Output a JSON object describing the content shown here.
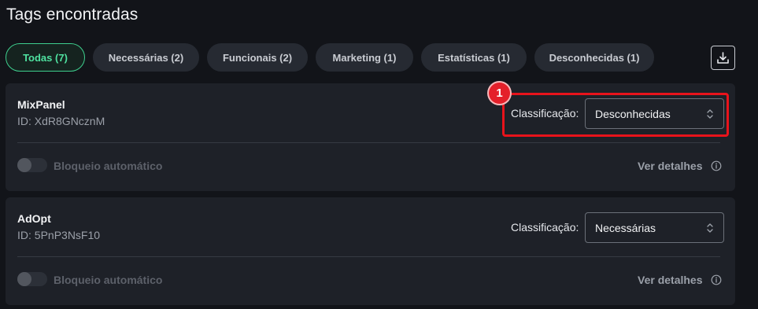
{
  "page": {
    "title": "Tags encontradas"
  },
  "filters": [
    {
      "label": "Todas (7)",
      "active": true
    },
    {
      "label": "Necessárias (2)",
      "active": false
    },
    {
      "label": "Funcionais (2)",
      "active": false
    },
    {
      "label": "Marketing (1)",
      "active": false
    },
    {
      "label": "Estatísticas (1)",
      "active": false
    },
    {
      "label": "Desconhecidas (1)",
      "active": false
    }
  ],
  "download": {
    "icon": "download-icon"
  },
  "tags": [
    {
      "name": "MixPanel",
      "id": "ID: XdR8GNcznM",
      "classification_label": "Classificação:",
      "classification_value": "Desconhecidas",
      "auto_block_label": "Bloqueio automático",
      "auto_block_enabled": false,
      "details_label": "Ver detalhes"
    },
    {
      "name": "AdOpt",
      "id": "ID: 5PnP3NsF10",
      "classification_label": "Classificação:",
      "classification_value": "Necessárias",
      "auto_block_label": "Bloqueio automático",
      "auto_block_enabled": false,
      "details_label": "Ver detalhes"
    }
  ],
  "annotation": {
    "badge": "1"
  },
  "colors": {
    "background": "#121419",
    "card": "#1e2128",
    "accent": "#3ecf8e",
    "highlight": "#e8131b"
  }
}
